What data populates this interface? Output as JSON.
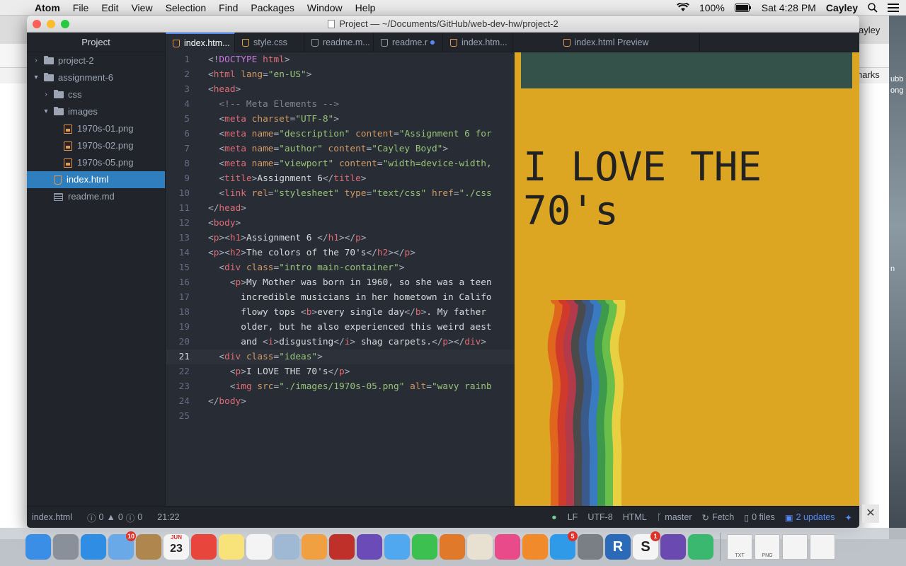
{
  "menubar": {
    "apple": "",
    "items": [
      "Atom",
      "File",
      "Edit",
      "View",
      "Selection",
      "Find",
      "Packages",
      "Window",
      "Help"
    ],
    "battery": "100%",
    "clock": "Sat 4:28 PM",
    "user": "Cayley"
  },
  "background": {
    "tab_text": "ayley",
    "bookmarks": "narks",
    "right_a": "ubb",
    "right_b": "ong",
    "right_c": "n"
  },
  "window": {
    "title": "Project — ~/Documents/GitHub/web-dev-hw/project-2"
  },
  "sidebar": {
    "header": "Project",
    "items": [
      {
        "label": "project-2",
        "type": "folder",
        "level": 0,
        "expanded": false
      },
      {
        "label": "assignment-6",
        "type": "folder",
        "level": 0,
        "expanded": true
      },
      {
        "label": "css",
        "type": "folder",
        "level": 1,
        "expanded": false
      },
      {
        "label": "images",
        "type": "folder",
        "level": 1,
        "expanded": true
      },
      {
        "label": "1970s-01.png",
        "type": "image",
        "level": 2
      },
      {
        "label": "1970s-02.png",
        "type": "image",
        "level": 2
      },
      {
        "label": "1970s-05.png",
        "type": "image",
        "level": 2
      },
      {
        "label": "index.html",
        "type": "html",
        "level": 1,
        "selected": true
      },
      {
        "label": "readme.md",
        "type": "md",
        "level": 1
      }
    ]
  },
  "tabs": [
    {
      "label": "index.htm...",
      "icon": "html-icon",
      "active": true
    },
    {
      "label": "style.css",
      "icon": "css-icon"
    },
    {
      "label": "readme.m...",
      "icon": "md-icon"
    },
    {
      "label": "readme.r",
      "icon": "md-icon",
      "modified": true
    },
    {
      "label": "index.htm...",
      "icon": "html-icon"
    },
    {
      "label": "index.html Preview",
      "icon": "html-icon",
      "preview": true
    }
  ],
  "editor": {
    "current_line": 21,
    "lines": [
      [
        [
          "pu",
          "<!"
        ],
        [
          "dt",
          "DOCTYPE"
        ],
        [
          "tg",
          " html"
        ],
        [
          "pu",
          ">"
        ]
      ],
      [
        [
          "pu",
          "<"
        ],
        [
          "tg",
          "html"
        ],
        [
          "at",
          " lang"
        ],
        [
          "pu",
          "="
        ],
        [
          "st",
          "\"en-US\""
        ],
        [
          "pu",
          ">"
        ]
      ],
      [
        [
          "pu",
          "<"
        ],
        [
          "tg",
          "head"
        ],
        [
          "pu",
          ">"
        ]
      ],
      [
        [
          "cm",
          "  <!-- Meta Elements -->"
        ]
      ],
      [
        [
          "pu",
          "  <"
        ],
        [
          "tg",
          "meta"
        ],
        [
          "at",
          " charset"
        ],
        [
          "pu",
          "="
        ],
        [
          "st",
          "\"UTF-8\""
        ],
        [
          "pu",
          ">"
        ]
      ],
      [
        [
          "pu",
          "  <"
        ],
        [
          "tg",
          "meta"
        ],
        [
          "at",
          " name"
        ],
        [
          "pu",
          "="
        ],
        [
          "st",
          "\"description\""
        ],
        [
          "at",
          " content"
        ],
        [
          "pu",
          "="
        ],
        [
          "st",
          "\"Assignment 6 for"
        ]
      ],
      [
        [
          "pu",
          "  <"
        ],
        [
          "tg",
          "meta"
        ],
        [
          "at",
          " name"
        ],
        [
          "pu",
          "="
        ],
        [
          "st",
          "\"author\""
        ],
        [
          "at",
          " content"
        ],
        [
          "pu",
          "="
        ],
        [
          "st",
          "\"Cayley Boyd\""
        ],
        [
          "pu",
          ">"
        ]
      ],
      [
        [
          "pu",
          "  <"
        ],
        [
          "tg",
          "meta"
        ],
        [
          "at",
          " name"
        ],
        [
          "pu",
          "="
        ],
        [
          "st",
          "\"viewport\""
        ],
        [
          "at",
          " content"
        ],
        [
          "pu",
          "="
        ],
        [
          "st",
          "\"width=device-width,"
        ]
      ],
      [
        [
          "pu",
          "  <"
        ],
        [
          "tg",
          "title"
        ],
        [
          "pu",
          ">"
        ],
        [
          "tx",
          "Assignment 6"
        ],
        [
          "pu",
          "</"
        ],
        [
          "tg",
          "title"
        ],
        [
          "pu",
          ">"
        ]
      ],
      [
        [
          "pu",
          "  <"
        ],
        [
          "tg",
          "link"
        ],
        [
          "at",
          " rel"
        ],
        [
          "pu",
          "="
        ],
        [
          "st",
          "\"stylesheet\""
        ],
        [
          "at",
          " type"
        ],
        [
          "pu",
          "="
        ],
        [
          "st",
          "\"text/css\""
        ],
        [
          "at",
          " href"
        ],
        [
          "pu",
          "="
        ],
        [
          "st",
          "\"./css"
        ]
      ],
      [
        [
          "pu",
          "</"
        ],
        [
          "tg",
          "head"
        ],
        [
          "pu",
          ">"
        ]
      ],
      [
        [
          "pu",
          "<"
        ],
        [
          "tg",
          "body"
        ],
        [
          "pu",
          ">"
        ]
      ],
      [
        [
          "pu",
          "<"
        ],
        [
          "tg",
          "p"
        ],
        [
          "pu",
          "><"
        ],
        [
          "tg",
          "h1"
        ],
        [
          "pu",
          ">"
        ],
        [
          "tx",
          "Assignment 6 "
        ],
        [
          "pu",
          "</"
        ],
        [
          "tg",
          "h1"
        ],
        [
          "pu",
          "></"
        ],
        [
          "tg",
          "p"
        ],
        [
          "pu",
          ">"
        ]
      ],
      [
        [
          "pu",
          "<"
        ],
        [
          "tg",
          "p"
        ],
        [
          "pu",
          "><"
        ],
        [
          "tg",
          "h2"
        ],
        [
          "pu",
          ">"
        ],
        [
          "tx",
          "The colors of the 70's"
        ],
        [
          "pu",
          "</"
        ],
        [
          "tg",
          "h2"
        ],
        [
          "pu",
          "></"
        ],
        [
          "tg",
          "p"
        ],
        [
          "pu",
          ">"
        ]
      ],
      [
        [
          "pu",
          "  <"
        ],
        [
          "tg",
          "div"
        ],
        [
          "at",
          " class"
        ],
        [
          "pu",
          "="
        ],
        [
          "st",
          "\"intro main-container\""
        ],
        [
          "pu",
          ">"
        ]
      ],
      [
        [
          "pu",
          "    <"
        ],
        [
          "tg",
          "p"
        ],
        [
          "pu",
          ">"
        ],
        [
          "tx",
          "My Mother was born in 1960, so she was a teen"
        ]
      ],
      [
        [
          "tx",
          "      incredible musicians in her hometown in Califo"
        ]
      ],
      [
        [
          "tx",
          "      flowy tops "
        ],
        [
          "pu",
          "<"
        ],
        [
          "tg",
          "b"
        ],
        [
          "pu",
          ">"
        ],
        [
          "tx",
          "every single day"
        ],
        [
          "pu",
          "</"
        ],
        [
          "tg",
          "b"
        ],
        [
          "pu",
          ">"
        ],
        [
          "tx",
          ". My father"
        ]
      ],
      [
        [
          "tx",
          "      older, but he also experienced this weird aest"
        ]
      ],
      [
        [
          "tx",
          "      and "
        ],
        [
          "pu",
          "<"
        ],
        [
          "tg",
          "i"
        ],
        [
          "pu",
          ">"
        ],
        [
          "tx",
          "disgusting"
        ],
        [
          "pu",
          "</"
        ],
        [
          "tg",
          "i"
        ],
        [
          "pu",
          ">"
        ],
        [
          "tx",
          " shag carpets."
        ],
        [
          "pu",
          "</"
        ],
        [
          "tg",
          "p"
        ],
        [
          "pu",
          "></"
        ],
        [
          "tg",
          "div"
        ],
        [
          "pu",
          ">"
        ]
      ],
      [
        [
          "pu",
          "  <"
        ],
        [
          "tg",
          "div"
        ],
        [
          "at",
          " class"
        ],
        [
          "pu",
          "="
        ],
        [
          "st",
          "\"ideas\""
        ],
        [
          "pu",
          ">"
        ]
      ],
      [
        [
          "pu",
          "    <"
        ],
        [
          "tg",
          "p"
        ],
        [
          "pu",
          ">"
        ],
        [
          "tx",
          "I LOVE THE 70's"
        ],
        [
          "pu",
          "</"
        ],
        [
          "tg",
          "p"
        ],
        [
          "pu",
          ">"
        ]
      ],
      [
        [
          "pu",
          "    <"
        ],
        [
          "tg",
          "img"
        ],
        [
          "at",
          " src"
        ],
        [
          "pu",
          "="
        ],
        [
          "st",
          "\"./images/1970s-05.png\""
        ],
        [
          "at",
          " alt"
        ],
        [
          "pu",
          "="
        ],
        [
          "st",
          "\"wavy rainb"
        ]
      ],
      [
        [
          "pu",
          "</"
        ],
        [
          "tg",
          "body"
        ],
        [
          "pu",
          ">"
        ]
      ],
      []
    ]
  },
  "preview": {
    "heading": "I LOVE THE 70's",
    "banner_color": "#34514a",
    "background_color": "#dca622",
    "rainbow_colors": [
      "#dca622",
      "#e0661e",
      "#cf3a2c",
      "#b23a4a",
      "#4a4a4a",
      "#3a5a8c",
      "#3a7ac0",
      "#3c9a4a",
      "#6abf4a",
      "#e8d040"
    ]
  },
  "statusbar": {
    "file": "index.html",
    "errors": "0",
    "warnings": "0",
    "infos": "0",
    "cursor": "21:22",
    "line_ending": "LF",
    "encoding": "UTF-8",
    "grammar": "HTML",
    "branch": "master",
    "fetch": "Fetch",
    "files": "0 files",
    "updates": "2 updates"
  },
  "dock": {
    "apps": [
      {
        "name": "finder-icon",
        "color": "#3a8ee6"
      },
      {
        "name": "launchpad-icon",
        "color": "#8a9099"
      },
      {
        "name": "safari-icon",
        "color": "#2f8de4"
      },
      {
        "name": "mail-icon",
        "color": "#6aa9e8",
        "badge": "10"
      },
      {
        "name": "contacts-icon",
        "color": "#b0864f"
      },
      {
        "name": "calendar-icon",
        "color": "#f4f4f4",
        "label": "23",
        "month": "JUN"
      },
      {
        "name": "chrome-icon",
        "color": "#e8453c"
      },
      {
        "name": "notes-icon",
        "color": "#f7e37a"
      },
      {
        "name": "reminders-icon",
        "color": "#f4f4f4"
      },
      {
        "name": "preview-icon",
        "color": "#9fb8d4"
      },
      {
        "name": "photos-icon",
        "color": "#f0a040"
      },
      {
        "name": "photo-booth-icon",
        "color": "#c0302a"
      },
      {
        "name": "imovie-icon",
        "color": "#6b4bb8"
      },
      {
        "name": "messages-icon",
        "color": "#4fa8f0"
      },
      {
        "name": "facetime-icon",
        "color": "#3cc04f"
      },
      {
        "name": "garageband-icon",
        "color": "#e07a2a"
      },
      {
        "name": "ibooks-author-icon",
        "color": "#e8e0d0"
      },
      {
        "name": "itunes-icon",
        "color": "#e84a8a"
      },
      {
        "name": "ibooks-icon",
        "color": "#f08a2a"
      },
      {
        "name": "app-store-icon",
        "color": "#2f9ae8",
        "badge": "5"
      },
      {
        "name": "system-preferences-icon",
        "color": "#7a7f86"
      },
      {
        "name": "r-icon",
        "color": "#2a6ab8",
        "label": "R"
      },
      {
        "name": "slack-icon",
        "color": "#f4f4f4",
        "badge": "1",
        "label": "S"
      },
      {
        "name": "github-icon",
        "color": "#6a4ab0"
      },
      {
        "name": "atom-icon",
        "color": "#3ab870"
      }
    ],
    "docs": [
      {
        "name": "txt-file-icon",
        "label": "TXT"
      },
      {
        "name": "png-file-icon",
        "label": "PNG"
      },
      {
        "name": "downloads-icon",
        "label": ""
      },
      {
        "name": "trash-icon",
        "label": ""
      }
    ]
  }
}
